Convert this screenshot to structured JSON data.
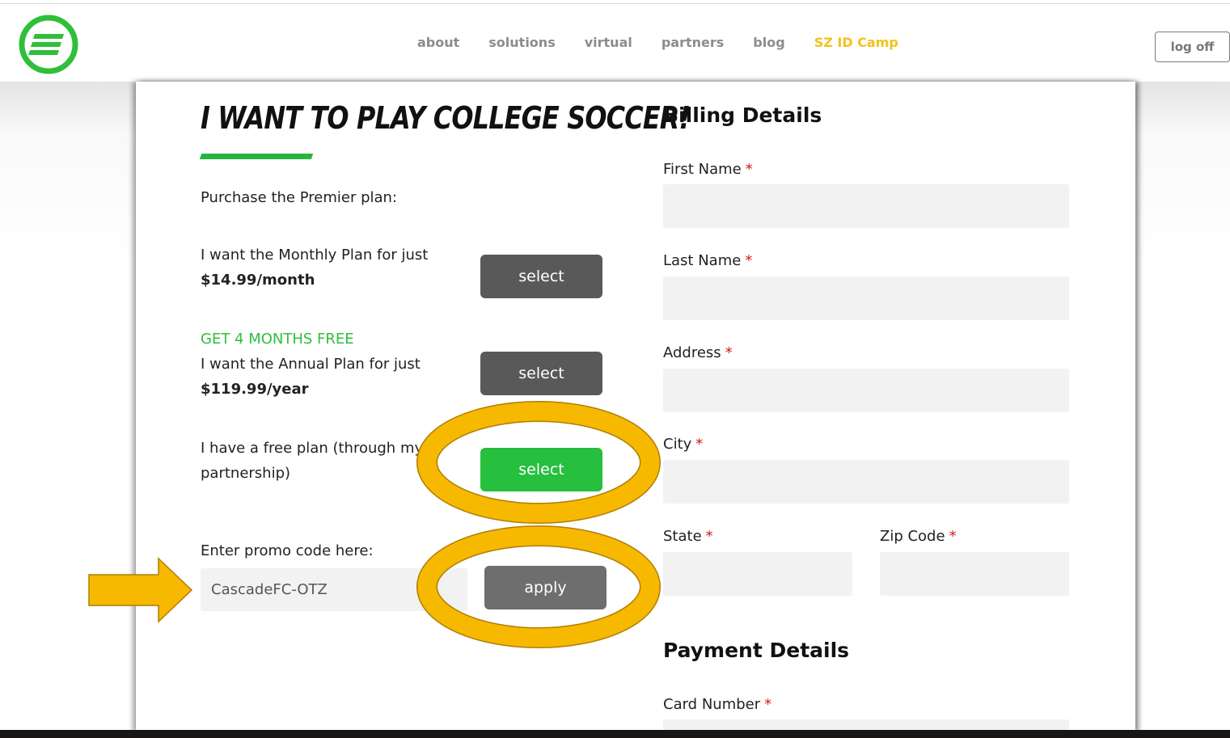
{
  "nav": {
    "links": [
      "about",
      "solutions",
      "virtual",
      "partners",
      "blog"
    ],
    "camp_link": "SZ ID Camp",
    "logoff": "log off"
  },
  "colors": {
    "brand_green": "#2fbf3a",
    "camp_link": "#f2c21b",
    "annotation": "#f7b900"
  },
  "plans": {
    "heading": "I WANT TO PLAY COLLEGE SOCCER!",
    "intro": "Purchase the Premier plan:",
    "monthly": {
      "line1": "I want the Monthly Plan for just",
      "price": "$14.99/month",
      "button": "select"
    },
    "annual": {
      "badge": "GET 4 MONTHS FREE",
      "line1": "I want the Annual Plan for just",
      "price": "$119.99/year",
      "button": "select"
    },
    "free": {
      "line1": "I have a free plan (through my c",
      "line2": "partnership)",
      "button": "select"
    },
    "promo": {
      "label": "Enter promo code here:",
      "value": "CascadeFC-OTZ",
      "button": "apply"
    }
  },
  "billing": {
    "title": "Billing Details",
    "first_name": "First Name",
    "last_name": "Last Name",
    "address": "Address",
    "city": "City",
    "state": "State",
    "zip": "Zip Code",
    "required_mark": "*"
  },
  "payment": {
    "title": "Payment Details",
    "card_number": "Card Number",
    "required_mark": "*"
  }
}
